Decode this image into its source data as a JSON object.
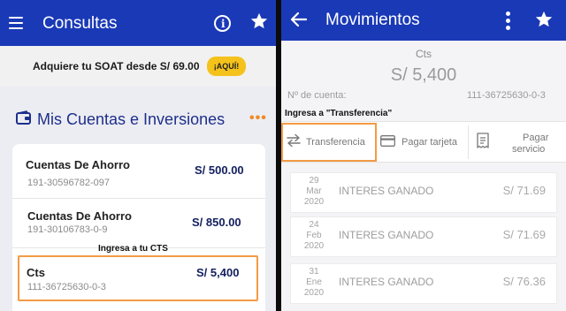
{
  "left": {
    "header": {
      "title": "Consultas",
      "icons": [
        "menu-icon",
        "info-icon",
        "star-icon"
      ]
    },
    "promo": {
      "text": "Adquiere tu SOAT desde S/ 69.00",
      "button": "¡AQUÍ!"
    },
    "section": {
      "title": "Mis Cuentas e Inversiones",
      "more": "•••"
    },
    "accounts": [
      {
        "name": "Cuentas De Ahorro",
        "number": "191-30596782-097",
        "amount": "S/ 500.00"
      },
      {
        "name": "Cuentas De Ahorro",
        "number": "191-30106783-0-9",
        "amount": "S/  850.00"
      },
      {
        "name": "Cts",
        "number": "111-36725630-0-3",
        "amount": "S/ 5,400"
      }
    ],
    "cts_annotation": "Ingresa a tu CTS",
    "colors": {
      "header": "#1a39b7",
      "accent": "#f39a45",
      "promo_button": "#f4c21b"
    }
  },
  "right": {
    "header": {
      "title": "Movimientos",
      "icons": [
        "back-arrow-icon",
        "kebab-menu-icon",
        "star-icon"
      ]
    },
    "account": {
      "label": "Cts",
      "amount": "S/ 5,400",
      "number_label": "Nº de cuenta:",
      "number": "111-36725630-0-3"
    },
    "annotation": "Ingresa a \"Transferencia\"",
    "actions": [
      {
        "label": "Transferencia",
        "icon": "transfer-icon"
      },
      {
        "label": "Pagar tarjeta",
        "icon": "card-icon"
      },
      {
        "label_line1": "Pagar",
        "label_line2": "servicio",
        "icon": "receipt-icon"
      }
    ],
    "movements": [
      {
        "day": "29",
        "month": "Mar",
        "year": "2020",
        "desc": "INTERES GANADO",
        "amount": "S/  71.69"
      },
      {
        "day": "24",
        "month": "Feb",
        "year": "2020",
        "desc": "INTERES GANADO",
        "amount": "S/ 71.69"
      },
      {
        "day": "31",
        "month": "Ene",
        "year": "2020",
        "desc": "INTERES GANADO",
        "amount": "S/  76.36"
      }
    ]
  }
}
